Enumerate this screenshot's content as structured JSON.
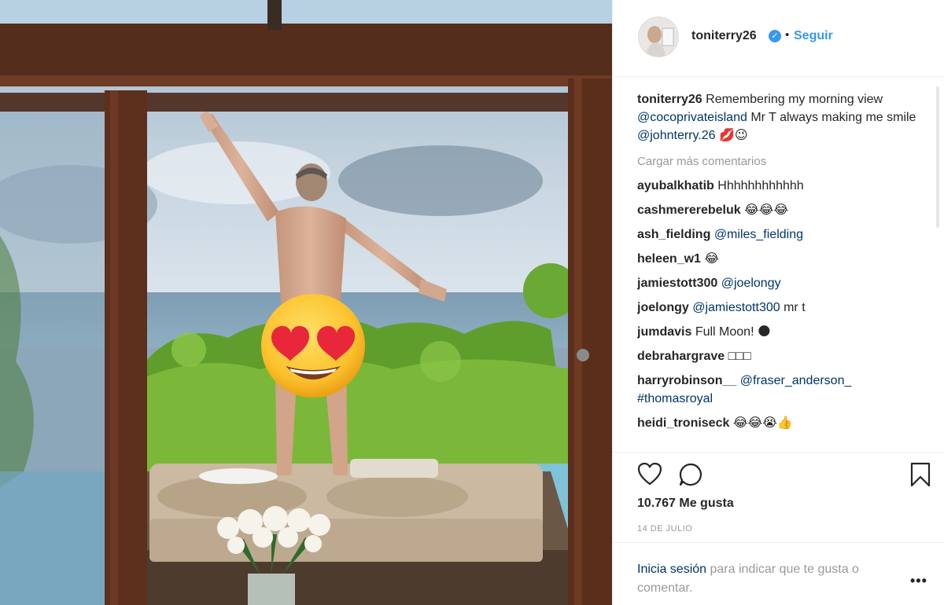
{
  "post": {
    "username": "toniterry26",
    "follow_label": "Seguir",
    "separator": "•",
    "caption": {
      "user": "toniterry26",
      "text1": " Remembering my morning view ",
      "mention1": "@cocoprivateisland",
      "text2": " Mr T always making me smile ",
      "mention2": "@johnterry.26",
      "emojis": " 💋😉"
    },
    "load_more": "Cargar más comentarios",
    "comments": [
      {
        "user": "ayubalkhatib",
        "text": "Hhhhhhhhhhhh"
      },
      {
        "user": "cashmererebeluk",
        "text": "😂😂😂"
      },
      {
        "user": "ash_fielding",
        "mention": "@miles_fielding"
      },
      {
        "user": "heleen_w1",
        "text": "😂"
      },
      {
        "user": "jamiestott300",
        "mention": "@joelongy"
      },
      {
        "user": "joelongy",
        "mention": "@jamiestott300",
        "text": "mr t"
      },
      {
        "user": "jumdavis",
        "text": "Full Moon! 🌑"
      },
      {
        "user": "debrahargrave",
        "text": "□□□"
      },
      {
        "user": "harryrobinson__",
        "mention": "@fraser_anderson_ #thomasroyal"
      },
      {
        "user": "heidi_troniseck",
        "text": "😂😂😭👍"
      }
    ],
    "likes": "10.767 Me gusta",
    "date": "14 DE JULIO",
    "login_link": "Inicia sesión",
    "login_rest": " para indicar que te gusta o comentar.",
    "more_label": "•••"
  },
  "icons": {
    "like": "heart-icon",
    "comment": "comment-icon",
    "save": "bookmark-icon",
    "verified": "verified-badge-icon",
    "more": "more-options-icon",
    "sticker": "heart-eyes-emoji"
  },
  "colors": {
    "link": "#3897f0",
    "mention": "#003569",
    "muted": "#999999",
    "text": "#262626"
  }
}
